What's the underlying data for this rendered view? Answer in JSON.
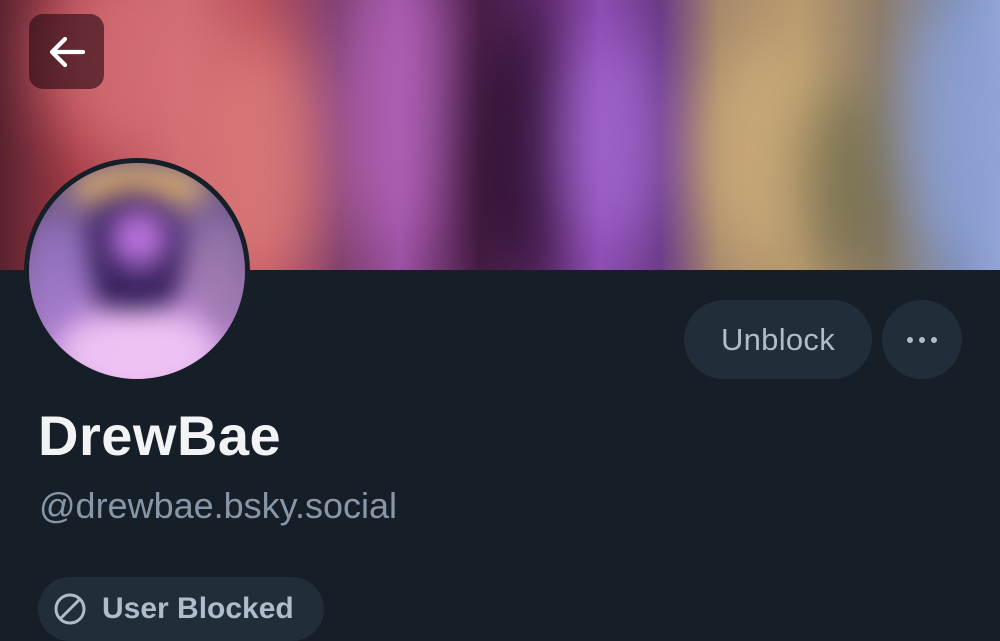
{
  "profile": {
    "display_name": "DrewBae",
    "handle": "@drewbae.bsky.social"
  },
  "actions": {
    "unblock_label": "Unblock",
    "more_icon": "ellipsis-icon",
    "back_icon": "arrow-left-icon"
  },
  "status": {
    "blocked_label": "User Blocked",
    "blocked_icon": "ban-icon"
  },
  "colors": {
    "background": "#161e27",
    "button_bg": "#212d39",
    "button_text": "#aebccb",
    "name_text": "#f1f3f5",
    "handle_text": "#8797a8"
  }
}
